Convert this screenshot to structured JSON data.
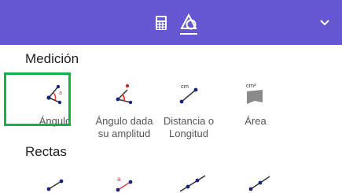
{
  "topbar": {
    "tabs": [
      {
        "icon": "calculator-icon"
      },
      {
        "icon": "shapes-tools-icon",
        "active": true
      }
    ],
    "collapse_icon": "chevron-down-icon",
    "color": "#6557d2"
  },
  "sections": {
    "medicion": {
      "title": "Medición",
      "tools": [
        {
          "label": "Ángulo",
          "icon": "angle-icon"
        },
        {
          "label": "Ángulo dada su amplitud",
          "label_lines": [
            "Ángulo dada",
            "su amplitud"
          ],
          "icon": "angle-fixed-size-icon"
        },
        {
          "label": "Distancia o Longitud",
          "label_lines": [
            "Distancia o",
            "Longitud"
          ],
          "icon": "distance-icon",
          "badge": "cm"
        },
        {
          "label": "Área",
          "icon": "area-icon",
          "badge": "cm²"
        }
      ]
    },
    "rectas": {
      "title": "Rectas",
      "tools": [
        {
          "icon": "segment-icon"
        },
        {
          "icon": "segment-fixed-length-icon",
          "badge": "a"
        },
        {
          "icon": "line-icon"
        },
        {
          "icon": "ray-icon"
        }
      ]
    }
  },
  "highlight_color": "#14b14b"
}
